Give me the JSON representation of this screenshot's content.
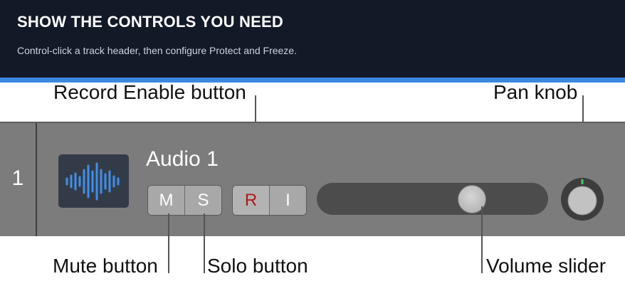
{
  "banner": {
    "title": "SHOW THE CONTROLS YOU NEED",
    "subtitle": "Control-click a track header, then configure Protect and Freeze."
  },
  "track": {
    "number": "1",
    "name": "Audio 1",
    "buttons": {
      "mute": "M",
      "solo": "S",
      "record": "R",
      "input": "I"
    },
    "volume_level": 0.7,
    "icon": "waveform-icon"
  },
  "callouts": {
    "record_enable": "Record Enable button",
    "pan_knob": "Pan knob",
    "mute": "Mute button",
    "solo": "Solo button",
    "volume": "Volume slider"
  },
  "colors": {
    "banner_bg": "#121927",
    "accent": "#3a88e0",
    "track_bg": "#7c7c7c",
    "record": "#b01818",
    "waveform": "#3f8fe8",
    "pan_indicator": "#3fcf5e"
  }
}
